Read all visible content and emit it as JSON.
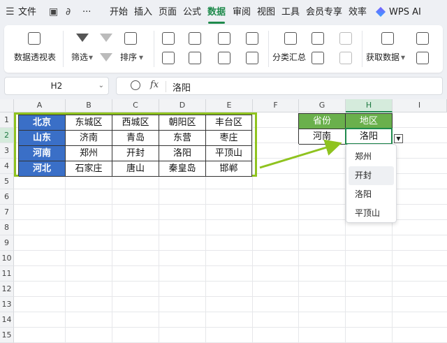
{
  "menu": {
    "file": "文件",
    "ellipsis": "···",
    "tabs": [
      "开始",
      "插入",
      "页面",
      "公式",
      "数据",
      "审阅",
      "视图",
      "工具",
      "会员专享",
      "效率"
    ],
    "active_tab": "数据",
    "wps_ai": "WPS AI"
  },
  "ribbon": {
    "pivot": "数据透视表",
    "filter": "筛选",
    "sort": "排序",
    "subtotal": "分类汇总",
    "get_data": "获取数据"
  },
  "formula_bar": {
    "name_box": "H2",
    "fx": "fx",
    "value": "洛阳"
  },
  "columns": [
    "A",
    "B",
    "C",
    "D",
    "E",
    "F",
    "G",
    "H",
    "I"
  ],
  "rows": [
    "1",
    "2",
    "3",
    "4",
    "5",
    "6",
    "7",
    "8",
    "9",
    "10",
    "11",
    "12",
    "13",
    "14",
    "15"
  ],
  "table": [
    [
      "北京",
      "东城区",
      "西城区",
      "朝阳区",
      "丰台区"
    ],
    [
      "山东",
      "济南",
      "青岛",
      "东营",
      "枣庄"
    ],
    [
      "河南",
      "郑州",
      "开封",
      "洛阳",
      "平顶山"
    ],
    [
      "河北",
      "石家庄",
      "唐山",
      "秦皇岛",
      "邯郸"
    ]
  ],
  "lookup": {
    "header_province": "省份",
    "header_region": "地区",
    "province": "河南",
    "region": "洛阳"
  },
  "dropdown": {
    "options": [
      "郑州",
      "开封",
      "洛阳",
      "平顶山"
    ],
    "highlighted": "开封"
  },
  "colors": {
    "accent": "#1f8a4c",
    "header_blue": "#3a6fc7",
    "header_green": "#6ab04c",
    "frame_green": "#8fc31f"
  }
}
